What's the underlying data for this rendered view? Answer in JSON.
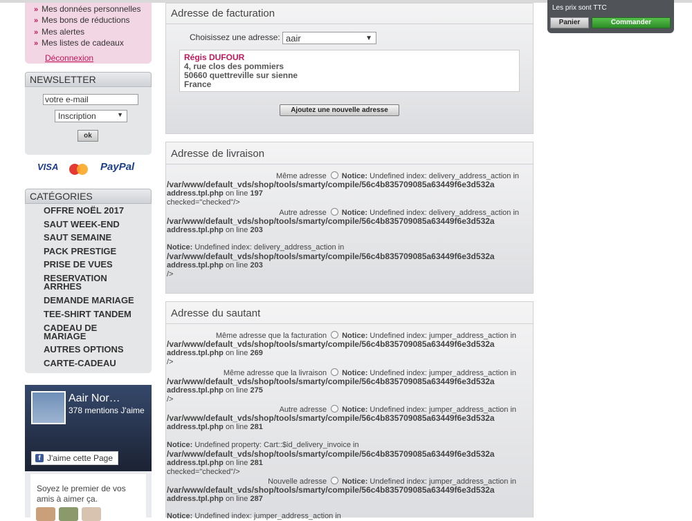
{
  "account_menu": {
    "items": [
      "Mes données personnelles",
      "Mes bons de réductions",
      "Mes alertes",
      "Mes listes de cadeaux"
    ],
    "logout": "Déconnexion"
  },
  "newsletter": {
    "title": "NEWSLETTER",
    "email_value": "votre e-mail",
    "select_value": "Inscription",
    "ok": "ok"
  },
  "payment": {
    "visa": "VISA",
    "mastercard": "MasterCard",
    "paypal": "PayPal"
  },
  "categories": {
    "title": "CATÉGORIES",
    "items": [
      "OFFRE NOËL 2017",
      "SAUT WEEK-END",
      "SAUT SEMAINE",
      "PACK PRESTIGE",
      "PRISE DE VUES",
      "RESERVATION ARRHES",
      "DEMANDE MARIAGE",
      "TEE-SHIRT TANDEM",
      "CADEAU DE MARIAGE",
      "AUTRES OPTIONS",
      "CARTE-CADEAU"
    ]
  },
  "facebook": {
    "page_name": "Aair Nor…",
    "likes": "378 mentions J'aime",
    "like_button": "J'aime cette Page",
    "first_text": "Soyez le premier de vos amis à aimer ça."
  },
  "billing": {
    "title": "Adresse de facturation",
    "choose_label": "Choisissez une adresse:",
    "selected": "aair",
    "address": {
      "name": "Régis DUFOUR",
      "street": "4, rue clos des pommiers",
      "city": "50660 quettreville sur sienne",
      "country": "France"
    },
    "add_button": "Ajoutez une nouvelle adresse"
  },
  "delivery": {
    "title": "Adresse de livraison",
    "opt1": {
      "label": "Même adresse",
      "notice": "Notice:",
      "message": "Undefined index: delivery_address_action in",
      "path": "/var/www/default_vds/shop/tools/smarty/compile/56c4b835709085a63449f6e3d532a",
      "file": "address.tpl.php",
      "on_line": "on line",
      "line": "197",
      "tail": "checked=\"checked\"/>"
    },
    "opt2": {
      "label": "Autre adresse",
      "notice": "Notice:",
      "message": "Undefined index: delivery_address_action in",
      "path": "/var/www/default_vds/shop/tools/smarty/compile/56c4b835709085a63449f6e3d532a",
      "file": "address.tpl.php",
      "on_line": "on line",
      "line": "203"
    },
    "notice3": {
      "notice": "Notice:",
      "message": "Undefined index: delivery_address_action in",
      "path": "/var/www/default_vds/shop/tools/smarty/compile/56c4b835709085a63449f6e3d532a",
      "file": "address.tpl.php",
      "on_line": "on line",
      "line": "203",
      "tail": "/>"
    }
  },
  "jumper": {
    "title": "Adresse du sautant",
    "opt1": {
      "label": "Même adresse que la facturation",
      "notice": "Notice:",
      "message": "Undefined index: jumper_address_action in",
      "path": "/var/www/default_vds/shop/tools/smarty/compile/56c4b835709085a63449f6e3d532a",
      "file": "address.tpl.php",
      "on_line": "on line",
      "line": "269",
      "tail": "/>"
    },
    "opt2": {
      "label": "Même adresse que la livraison",
      "notice": "Notice:",
      "message": "Undefined index: jumper_address_action in",
      "path": "/var/www/default_vds/shop/tools/smarty/compile/56c4b835709085a63449f6e3d532a",
      "file": "address.tpl.php",
      "on_line": "on line",
      "line": "275",
      "tail": "/>"
    },
    "opt3": {
      "label": "Autre adresse",
      "notice": "Notice:",
      "message": "Undefined index: jumper_address_action in",
      "path": "/var/www/default_vds/shop/tools/smarty/compile/56c4b835709085a63449f6e3d532a",
      "file": "address.tpl.php",
      "on_line": "on line",
      "line": "281"
    },
    "notice4": {
      "notice": "Notice:",
      "message": "Undefined property: Cart::$id_delivery_invoice in",
      "path": "/var/www/default_vds/shop/tools/smarty/compile/56c4b835709085a63449f6e3d532a",
      "file": "address.tpl.php",
      "on_line": "on line",
      "line": "281",
      "tail": "checked=\"checked\"/>"
    },
    "opt4": {
      "label": "Nouvelle adresse",
      "notice": "Notice:",
      "message": "Undefined index: jumper_address_action in",
      "path": "/var/www/default_vds/shop/tools/smarty/compile/56c4b835709085a63449f6e3d532a",
      "file": "address.tpl.php",
      "on_line": "on line",
      "line": "287"
    },
    "notice5": {
      "notice": "Notice:",
      "message": "Undefined index: jumper_address_action in"
    }
  },
  "cart": {
    "ttc": "Les prix sont TTC",
    "panier": "Panier",
    "commander": "Commander"
  },
  "colors": {
    "accent_pink": "#c2185b",
    "order_green": "#3aa534",
    "cart_bg": "#505358"
  }
}
